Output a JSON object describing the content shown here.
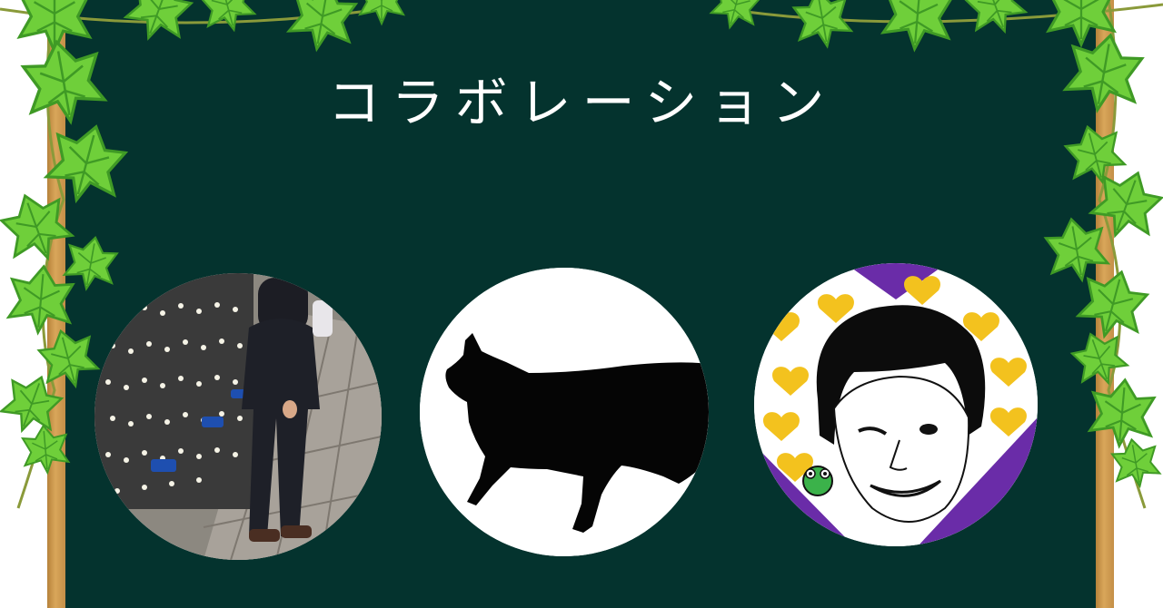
{
  "banner": {
    "title": "コラボレーション"
  },
  "colors": {
    "board": "#04332e",
    "frame_wood": "#c8924a",
    "ivy_leaf": "#6fcf3a",
    "ivy_leaf_dark": "#3f9a25",
    "heart": "#f3c21e",
    "purple": "#6a2ca8"
  },
  "avatars": [
    {
      "id": "photo-person",
      "icon": "person-photo"
    },
    {
      "id": "black-cat",
      "icon": "cat-silhouette-icon"
    },
    {
      "id": "illustrated-face",
      "icon": "winking-face-illustration"
    }
  ]
}
